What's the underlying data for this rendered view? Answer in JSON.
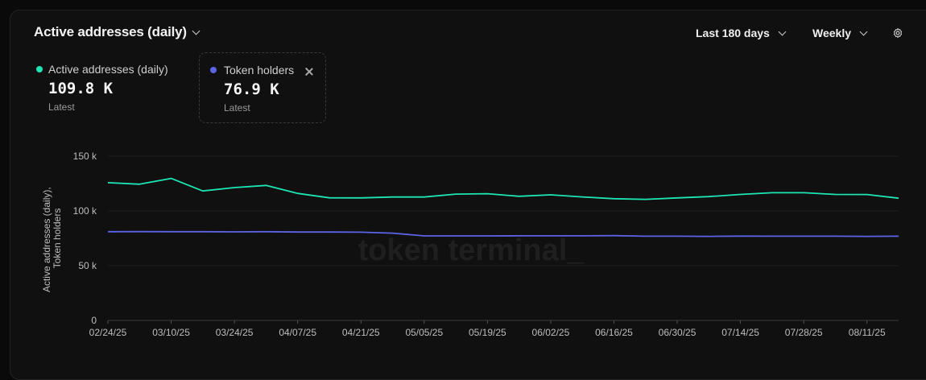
{
  "header": {
    "metric_selector": "Active addresses (daily)",
    "range_selector": "Last 180 days",
    "granularity_selector": "Weekly",
    "settings_icon": "gear-icon",
    "chevron_icon": "chevron-down-icon"
  },
  "legend": [
    {
      "name": "Active addresses (daily)",
      "value": "109.8 K",
      "sub": "Latest",
      "color": "#1de5b5"
    },
    {
      "name": "Token holders",
      "value": "76.9 K",
      "sub": "Latest",
      "color": "#5b64e6",
      "close_icon": "close-icon"
    }
  ],
  "watermark": "token terminal_",
  "chart_data": {
    "type": "line",
    "ylabel": "Active addresses (daily), Token holders",
    "ylim": [
      0,
      150000
    ],
    "yticks": [
      0,
      50000,
      100000,
      150000
    ],
    "ytick_labels": [
      "0",
      "50 k",
      "100 k",
      "150 k"
    ],
    "grid": true,
    "x": [
      "02/24/25",
      "03/03/25",
      "03/10/25",
      "03/17/25",
      "03/24/25",
      "03/31/25",
      "04/07/25",
      "04/14/25",
      "04/21/25",
      "04/28/25",
      "05/05/25",
      "05/12/25",
      "05/19/25",
      "05/26/25",
      "06/02/25",
      "06/09/25",
      "06/16/25",
      "06/23/25",
      "06/30/25",
      "07/07/25",
      "07/14/25",
      "07/21/25",
      "07/28/25",
      "08/04/25",
      "08/11/25",
      "08/18/25"
    ],
    "xtick_labels": [
      "02/24/25",
      "03/10/25",
      "03/24/25",
      "04/07/25",
      "04/21/25",
      "05/05/25",
      "05/19/25",
      "06/02/25",
      "06/16/25",
      "06/30/25",
      "07/14/25",
      "07/28/25",
      "08/11/25"
    ],
    "series": [
      {
        "name": "Active addresses (daily)",
        "color": "#1de5b5",
        "values": [
          125800,
          124400,
          129700,
          118200,
          121300,
          123300,
          116000,
          112000,
          111900,
          112700,
          112700,
          115400,
          115700,
          113400,
          114700,
          112800,
          111200,
          110600,
          111900,
          113100,
          115100,
          116600,
          116600,
          115100,
          115000,
          111600
        ]
      },
      {
        "name": "Token holders",
        "color": "#5b64e6",
        "values": [
          81000,
          81100,
          81000,
          81000,
          80900,
          81000,
          80700,
          80700,
          80600,
          79700,
          77200,
          77200,
          77200,
          77300,
          77300,
          77300,
          77400,
          76900,
          76900,
          76800,
          77000,
          76900,
          76900,
          76900,
          76800,
          76900
        ]
      }
    ]
  }
}
